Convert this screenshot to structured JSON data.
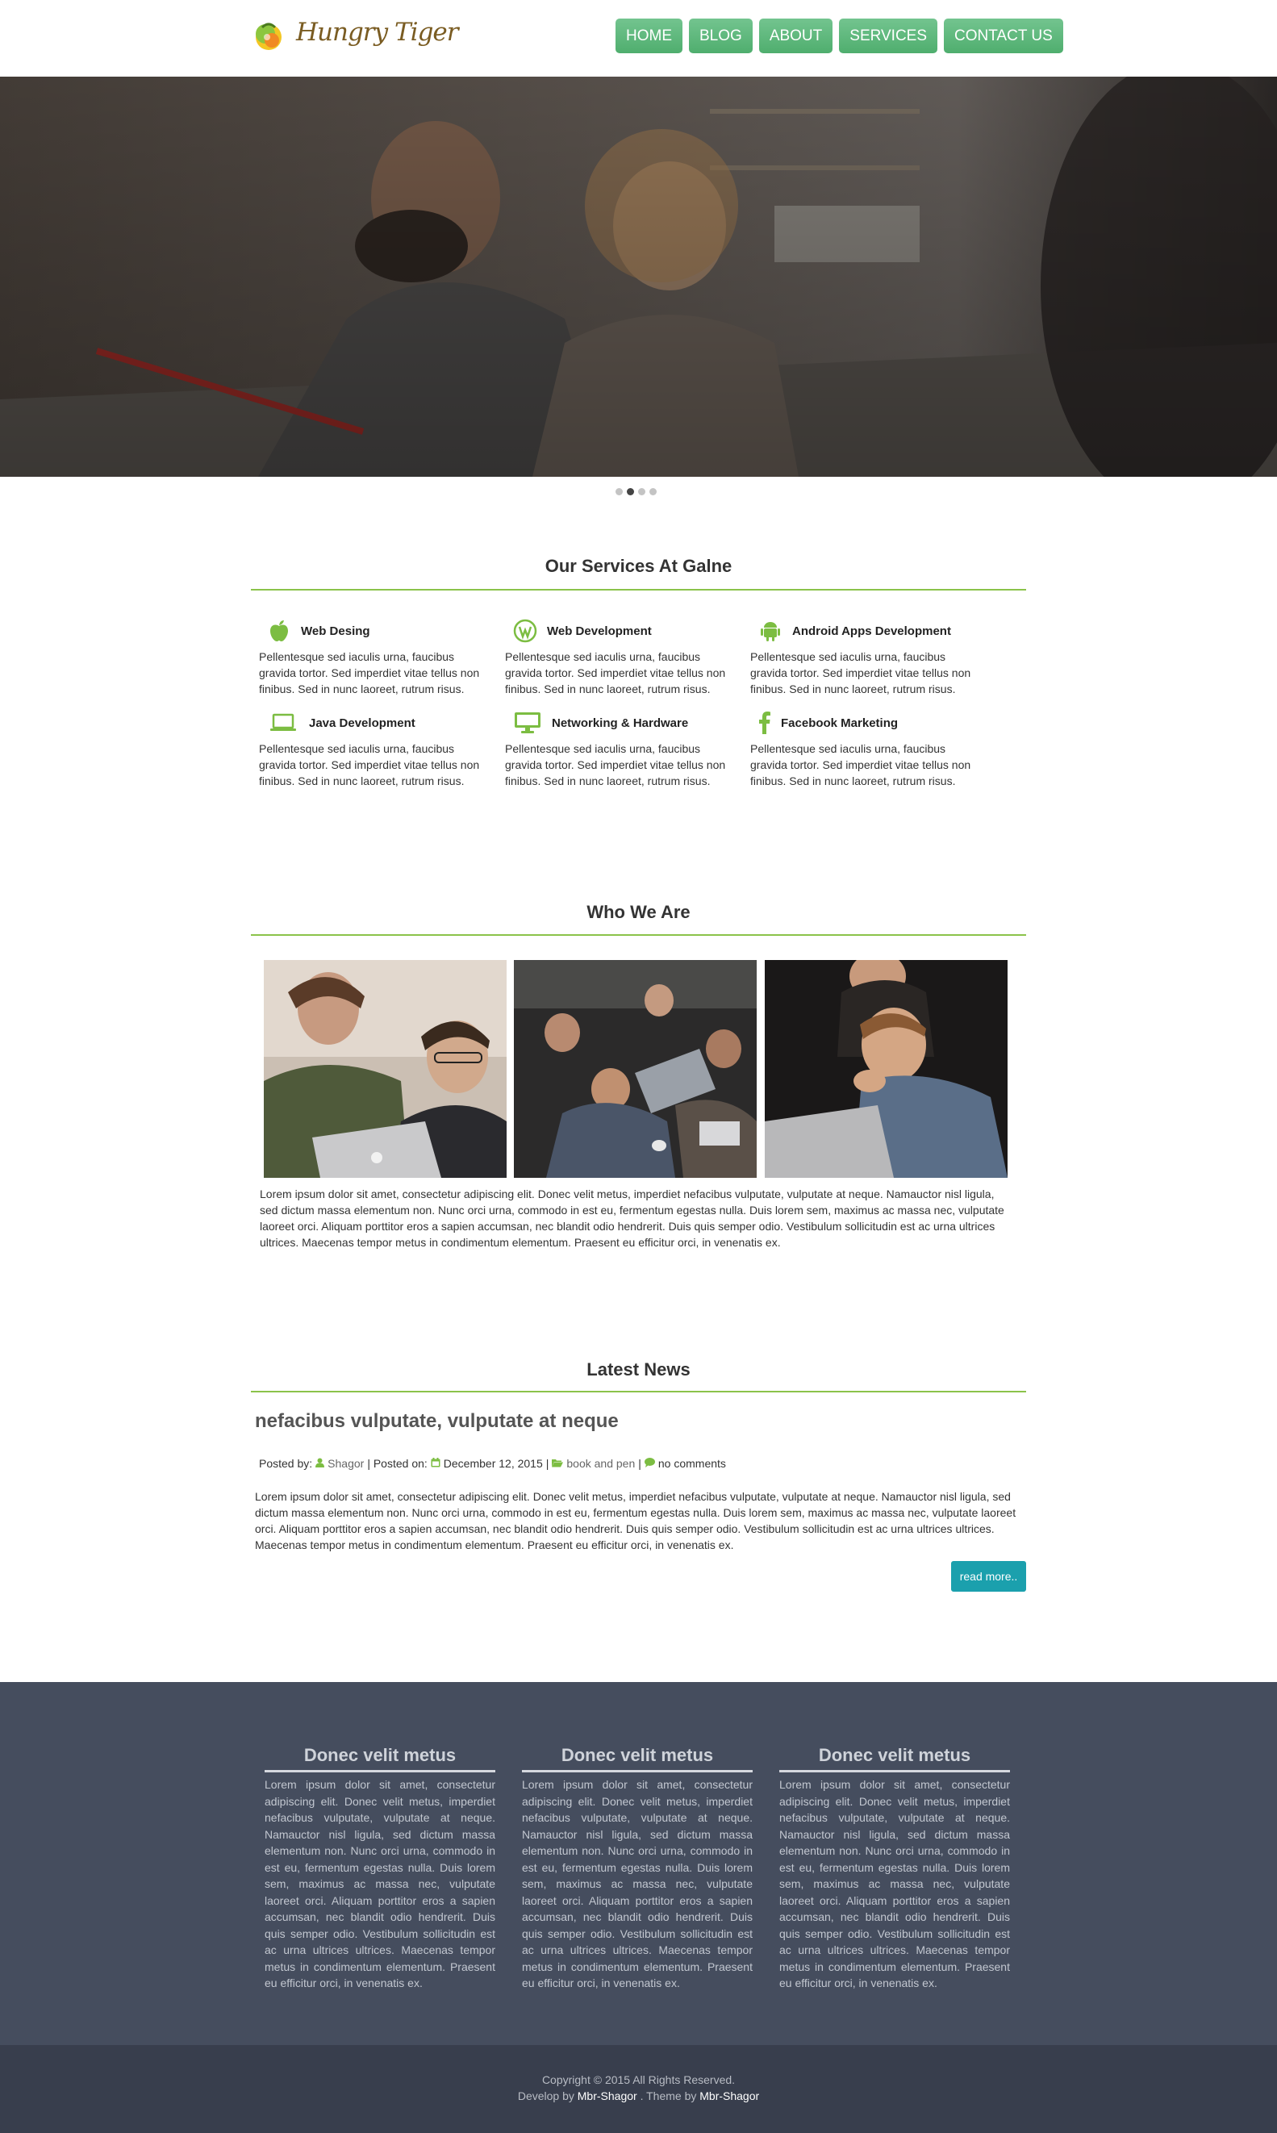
{
  "header": {
    "logo_text": "Hungry Tiger",
    "nav": [
      "HOME",
      "BLOG",
      "ABOUT",
      "SERVICES",
      "CONTACT US"
    ]
  },
  "slider": {
    "dots": 4,
    "active_dot": 2
  },
  "services": {
    "title": "Our Services At Galne",
    "items": [
      {
        "icon": "apple-icon",
        "title": "Web Desing",
        "text": "Pellentesque sed iaculis urna, faucibus gravida tortor. Sed imperdiet vitae tellus non finibus. Sed in nunc laoreet, rutrum risus."
      },
      {
        "icon": "wordpress-icon",
        "title": "Web Development",
        "text": "Pellentesque sed iaculis urna, faucibus gravida tortor. Sed imperdiet vitae tellus non finibus. Sed in nunc laoreet, rutrum risus."
      },
      {
        "icon": "android-icon",
        "title": "Android Apps Development",
        "text": "Pellentesque sed iaculis urna, faucibus gravida tortor. Sed imperdiet vitae tellus non finibus. Sed in nunc laoreet, rutrum risus."
      },
      {
        "icon": "laptop-icon",
        "title": "Java Development",
        "text": "Pellentesque sed iaculis urna, faucibus gravida tortor. Sed imperdiet vitae tellus non finibus. Sed in nunc laoreet, rutrum risus."
      },
      {
        "icon": "desktop-icon",
        "title": "Networking & Hardware",
        "text": "Pellentesque sed iaculis urna, faucibus gravida tortor. Sed imperdiet vitae tellus non finibus. Sed in nunc laoreet, rutrum risus."
      },
      {
        "icon": "facebook-icon",
        "title": "Facebook Marketing",
        "text": "Pellentesque sed iaculis urna, faucibus gravida tortor. Sed imperdiet vitae tellus non finibus. Sed in nunc laoreet, rutrum risus."
      }
    ]
  },
  "about": {
    "title": "Who We Are",
    "text": "Lorem ipsum dolor sit amet, consectetur adipiscing elit. Donec velit metus, imperdiet nefacibus vulputate, vulputate at neque. Namauctor nisl ligula, sed dictum massa elementum non. Nunc orci urna, commodo in est eu, fermentum egestas nulla. Duis lorem sem, maximus ac massa nec, vulputate laoreet orci. Aliquam porttitor eros a sapien accumsan, nec blandit odio hendrerit. Duis quis semper odio. Vestibulum sollicitudin est ac urna ultrices ultrices. Maecenas tempor metus in condimentum elementum. Praesent eu efficitur orci, in venenatis ex."
  },
  "news": {
    "section_title": "Latest News",
    "post_title": "nefacibus vulputate, vulputate at neque",
    "posted_by_label": "Posted by:",
    "author": "Shagor",
    "posted_on_label": "| Posted on:",
    "date": "December 12, 2015",
    "sep": "|",
    "category": "book and pen",
    "sep2": "|",
    "comments": "no comments",
    "body": "Lorem ipsum dolor sit amet, consectetur adipiscing elit. Donec velit metus, imperdiet nefacibus vulputate, vulputate at neque. Namauctor nisl ligula, sed dictum massa elementum non. Nunc orci urna, commodo in est eu, fermentum egestas nulla. Duis lorem sem, maximus ac massa nec, vulputate laoreet orci. Aliquam porttitor eros a sapien accumsan, nec blandit odio hendrerit. Duis quis semper odio. Vestibulum sollicitudin est ac urna ultrices ultrices. Maecenas tempor metus in condimentum elementum. Praesent eu efficitur orci, in venenatis ex.",
    "read_more": "read more.."
  },
  "footer": {
    "columns": [
      {
        "title": "Donec velit metus",
        "text": "Lorem ipsum dolor sit amet, consectetur adipiscing elit. Donec velit metus, imperdiet nefacibus vulputate, vulputate at neque. Namauctor nisl ligula, sed dictum massa elementum non. Nunc orci urna, commodo in est eu, fermentum egestas nulla. Duis lorem sem, maximus ac massa nec, vulputate laoreet orci. Aliquam porttitor eros a sapien accumsan, nec blandit odio hendrerit. Duis quis semper odio. Vestibulum sollicitudin est ac urna ultrices ultrices. Maecenas tempor metus in condimentum elementum. Praesent eu efficitur orci, in venenatis ex."
      },
      {
        "title": "Donec velit metus",
        "text": "Lorem ipsum dolor sit amet, consectetur adipiscing elit. Donec velit metus, imperdiet nefacibus vulputate, vulputate at neque. Namauctor nisl ligula, sed dictum massa elementum non. Nunc orci urna, commodo in est eu, fermentum egestas nulla. Duis lorem sem, maximus ac massa nec, vulputate laoreet orci. Aliquam porttitor eros a sapien accumsan, nec blandit odio hendrerit. Duis quis semper odio. Vestibulum sollicitudin est ac urna ultrices ultrices. Maecenas tempor metus in condimentum elementum. Praesent eu efficitur orci, in venenatis ex."
      },
      {
        "title": "Donec velit metus",
        "text": "Lorem ipsum dolor sit amet, consectetur adipiscing elit. Donec velit metus, imperdiet nefacibus vulputate, vulputate at neque. Namauctor nisl ligula, sed dictum massa elementum non. Nunc orci urna, commodo in est eu, fermentum egestas nulla. Duis lorem sem, maximus ac massa nec, vulputate laoreet orci. Aliquam porttitor eros a sapien accumsan, nec blandit odio hendrerit. Duis quis semper odio. Vestibulum sollicitudin est ac urna ultrices ultrices. Maecenas tempor metus in condimentum elementum. Praesent eu efficitur orci, in venenatis ex."
      }
    ],
    "copyright": "Copyright © 2015 All Rights Reserved.",
    "develop_label": "Develop by",
    "developer": "Mbr-Shagor",
    "theme_label": ". Theme by",
    "theme_author": "Mbr-Shagor"
  },
  "colors": {
    "accent_green": "#8bc34a",
    "nav_green": "#5cb87a",
    "button_teal": "#1ba0ad",
    "footer_bg": "#454d5e",
    "copyright_bg": "#383e4d"
  }
}
